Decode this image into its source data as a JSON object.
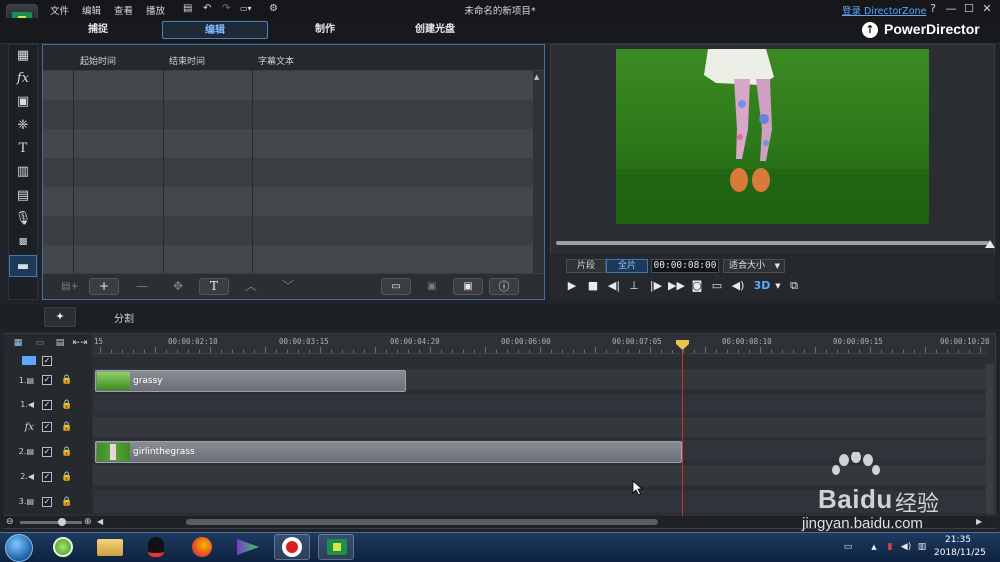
{
  "titlebar": {
    "menus": [
      "文件",
      "编辑",
      "查看",
      "播放"
    ],
    "title": "未命名的新项目*",
    "login": "登录 DirectorZone",
    "help": "?",
    "minimize": "—",
    "maximize": "☐",
    "close": "✕"
  },
  "modes": [
    "捕捉",
    "编辑",
    "制作",
    "创建光盘"
  ],
  "brand": "PowerDirector",
  "subtitle_panel": {
    "columns": [
      "起始时间",
      "结束时间",
      "字幕文本"
    ]
  },
  "preview": {
    "seg_clip": "片段",
    "seg_movie": "全片",
    "timecode": "00:00:08:00",
    "fit": "适合大小",
    "mode_3d": "3D"
  },
  "timeline_tools": {
    "split": "分割"
  },
  "ruler": {
    "labels": [
      "15",
      "00:00:02:10",
      "00:00:03:15",
      "00:00:04:20",
      "00:00:06:00",
      "00:00:07:05",
      "00:00:08:10",
      "00:00:09:15",
      "00:00:10:20"
    ]
  },
  "tracks": [
    {
      "label": "1.",
      "kind": "video"
    },
    {
      "label": "1.",
      "kind": "audio"
    },
    {
      "label": "fx",
      "kind": "effect"
    },
    {
      "label": "2.",
      "kind": "video"
    },
    {
      "label": "2.",
      "kind": "audio"
    },
    {
      "label": "3.",
      "kind": "video"
    }
  ],
  "clips": [
    {
      "name": "grassy"
    },
    {
      "name": "girlinthegrass"
    }
  ],
  "clock": {
    "time": "21:35",
    "date": "2018/11/25"
  },
  "watermark": {
    "brand": "Bai",
    "brand2": "du",
    "cn": "经验",
    "url": "jingyan.baidu.com"
  },
  "colors": {
    "accent": "#4c7fb6",
    "playhead": "#d62d2d",
    "link": "#5ea8ff"
  }
}
